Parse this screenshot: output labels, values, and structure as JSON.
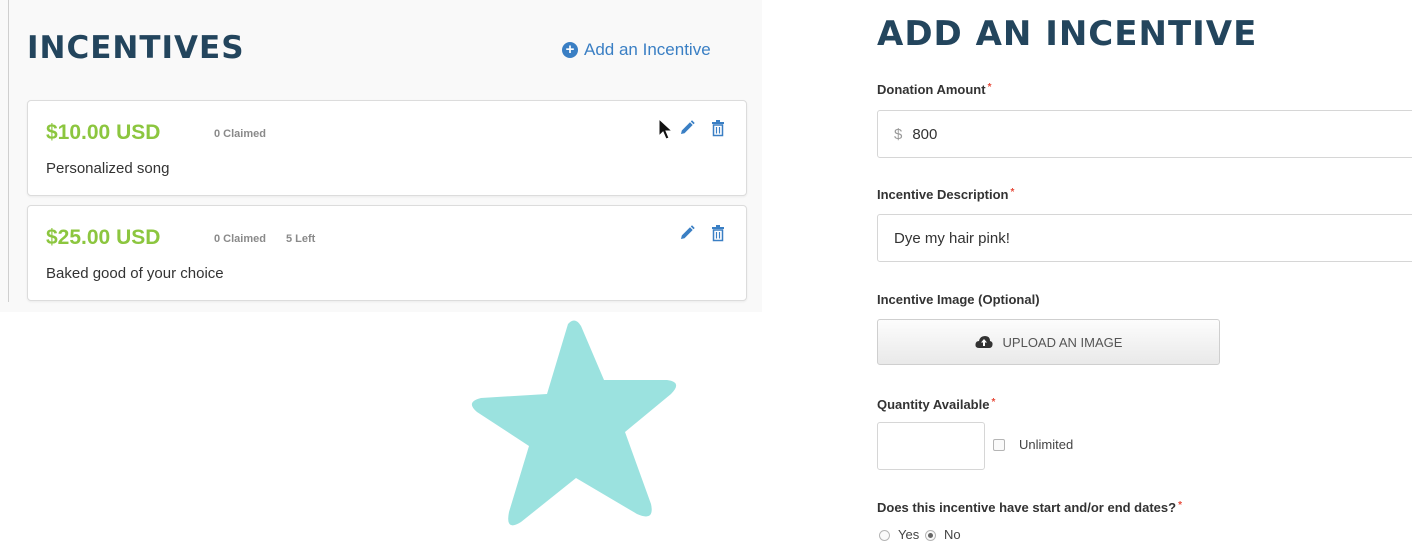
{
  "incentives": {
    "title": "INCENTIVES",
    "add_link": "Add an Incentive",
    "items": [
      {
        "amount": "$10.00 USD",
        "claimed": "0 Claimed",
        "left": "",
        "description": "Personalized song"
      },
      {
        "amount": "$25.00 USD",
        "claimed": "0 Claimed",
        "left": "5 Left",
        "description": "Baked good of your choice"
      }
    ]
  },
  "form": {
    "title": "ADD AN INCENTIVE",
    "donation_label": "Donation Amount",
    "currency_symbol": "$",
    "donation_value": "800",
    "description_label": "Incentive Description",
    "description_value": "Dye my hair pink!",
    "image_label": "Incentive Image (Optional)",
    "upload_button": "UPLOAD AN IMAGE",
    "quantity_label": "Quantity Available",
    "quantity_value": "",
    "unlimited_label": "Unlimited",
    "unlimited_checked": false,
    "dates_label": "Does this incentive have start and/or end dates?",
    "dates_options": [
      "Yes",
      "No"
    ],
    "dates_selected": "No",
    "required_mark": "*"
  },
  "colors": {
    "title": "#23455d",
    "link": "#3a7fc4",
    "amount": "#8cc63f",
    "required": "#e74c3c",
    "star": "#9be2df"
  },
  "icons": [
    "plus-circle-icon",
    "pencil-icon",
    "trash-icon",
    "cloud-upload-icon",
    "mouse-cursor-icon",
    "star-icon"
  ]
}
